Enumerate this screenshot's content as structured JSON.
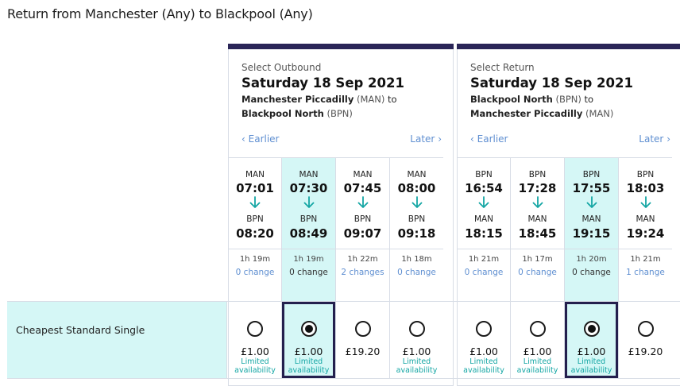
{
  "page": {
    "title": "Return from Manchester (Any) to Blackpool (Any)"
  },
  "row": {
    "label": "Cheapest Standard Single"
  },
  "outbound": {
    "label": "Select Outbound",
    "date": "Saturday 18 Sep 2021",
    "from_station": "Manchester Piccadilly",
    "from_code": "(MAN)",
    "to_word": "to",
    "to_station": "Blackpool North",
    "to_code": "(BPN)",
    "earlier": "Earlier",
    "later": "Later",
    "journeys": [
      {
        "from": "MAN",
        "dep": "07:01",
        "to": "BPN",
        "arr": "08:20",
        "duration": "1h 19m",
        "changes": "0 change",
        "price": "£1.00",
        "availability": "Limited availability",
        "selected": false
      },
      {
        "from": "MAN",
        "dep": "07:30",
        "to": "BPN",
        "arr": "08:49",
        "duration": "1h 19m",
        "changes": "0 change",
        "price": "£1.00",
        "availability": "Limited availability",
        "selected": true
      },
      {
        "from": "MAN",
        "dep": "07:45",
        "to": "BPN",
        "arr": "09:07",
        "duration": "1h 22m",
        "changes": "2 changes",
        "price": "£19.20",
        "availability": "",
        "selected": false
      },
      {
        "from": "MAN",
        "dep": "08:00",
        "to": "BPN",
        "arr": "09:18",
        "duration": "1h 18m",
        "changes": "0 change",
        "price": "£1.00",
        "availability": "Limited availability",
        "selected": false
      }
    ]
  },
  "return": {
    "label": "Select Return",
    "date": "Saturday 18 Sep 2021",
    "from_station": "Blackpool North",
    "from_code": "(BPN)",
    "to_word": "to",
    "to_station": "Manchester Piccadilly",
    "to_code": "(MAN)",
    "earlier": "Earlier",
    "later": "Later",
    "journeys": [
      {
        "from": "BPN",
        "dep": "16:54",
        "to": "MAN",
        "arr": "18:15",
        "duration": "1h 21m",
        "changes": "0 change",
        "price": "£1.00",
        "availability": "Limited availability",
        "selected": false
      },
      {
        "from": "BPN",
        "dep": "17:28",
        "to": "MAN",
        "arr": "18:45",
        "duration": "1h 17m",
        "changes": "0 change",
        "price": "£1.00",
        "availability": "Limited availability",
        "selected": false
      },
      {
        "from": "BPN",
        "dep": "17:55",
        "to": "MAN",
        "arr": "19:15",
        "duration": "1h 20m",
        "changes": "0 change",
        "price": "£1.00",
        "availability": "Limited availability",
        "selected": true
      },
      {
        "from": "BPN",
        "dep": "18:03",
        "to": "MAN",
        "arr": "19:24",
        "duration": "1h 21m",
        "changes": "1 change",
        "price": "£19.20",
        "availability": "",
        "selected": false
      }
    ]
  },
  "icons": {
    "journey_arrow": "arrow-down-icon",
    "earlier": "chevron-left-icon",
    "later": "chevron-right-icon"
  },
  "colors": {
    "accent_bar": "#2a2557",
    "selected_bg": "#d5f7f6",
    "teal": "#14a6a4",
    "link": "#5f8fd1"
  }
}
